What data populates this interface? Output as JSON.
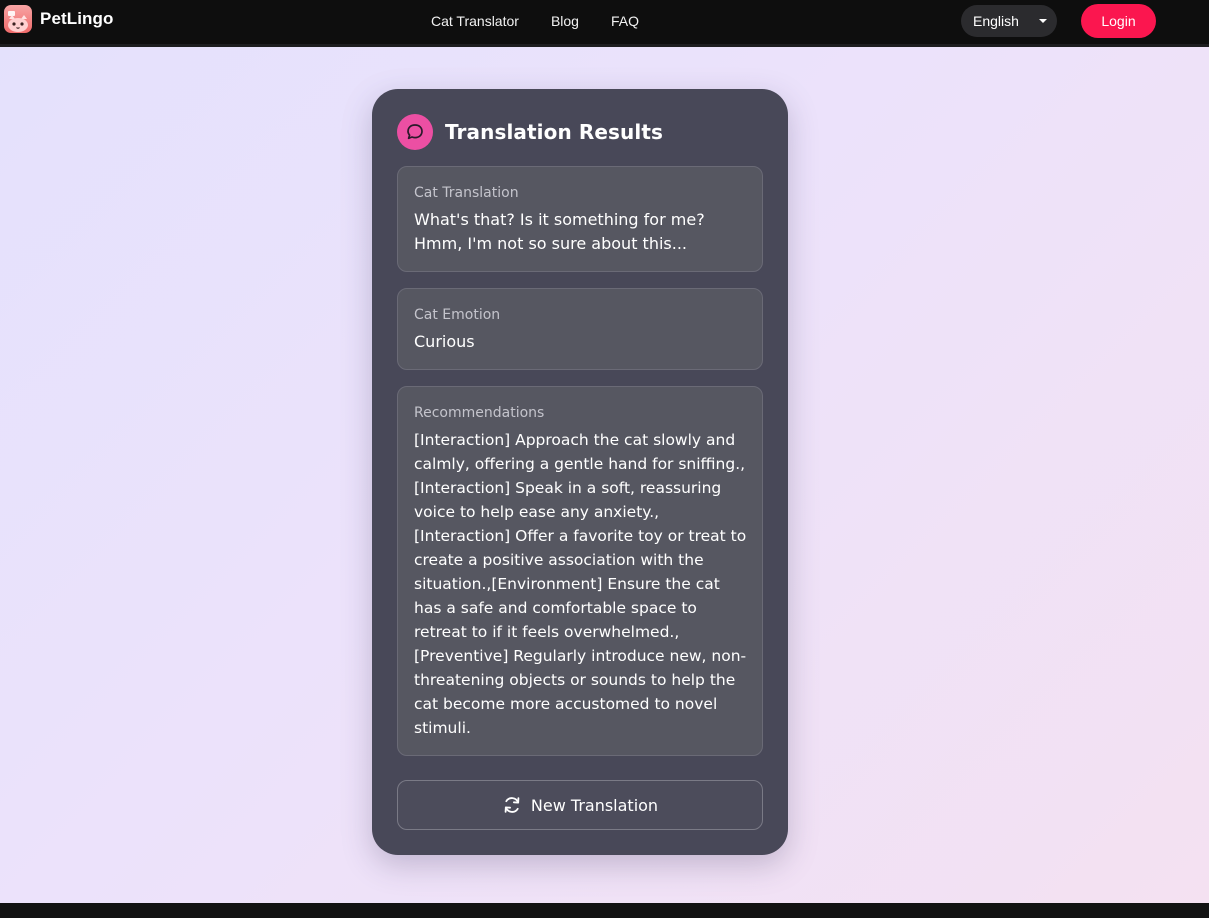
{
  "app": {
    "name": "PetLingo"
  },
  "nav": {
    "links": [
      "Cat Translator",
      "Blog",
      "FAQ"
    ],
    "language": "English",
    "login_label": "Login"
  },
  "results": {
    "title": "Translation Results",
    "translation": {
      "label": "Cat Translation",
      "text": "What's that? Is it something for me? Hmm, I'm not so sure about this..."
    },
    "emotion": {
      "label": "Cat Emotion",
      "text": "Curious"
    },
    "recommendations": {
      "label": "Recommendations",
      "text": "[Interaction] Approach the cat slowly and calmly, offering a gentle hand for sniffing.,[Interaction] Speak in a soft, reassuring voice to help ease any anxiety.,[Interaction] Offer a favorite toy or treat to create a positive association with the situation.,[Environment] Ensure the cat has a safe and comfortable space to retreat to if it feels overwhelmed.,[Preventive] Regularly introduce new, non-threatening objects or sounds to help the cat become more accustomed to novel stimuli."
    },
    "new_translation_label": "New Translation"
  },
  "icons": {
    "logo": "cat-logo-icon",
    "chat": "chat-bubble-icon",
    "caret": "caret-down-icon",
    "refresh": "refresh-icon"
  },
  "colors": {
    "accent": "#fb164f",
    "badge": "#ec4fa3",
    "card": "#484858",
    "panel": "#565761"
  }
}
